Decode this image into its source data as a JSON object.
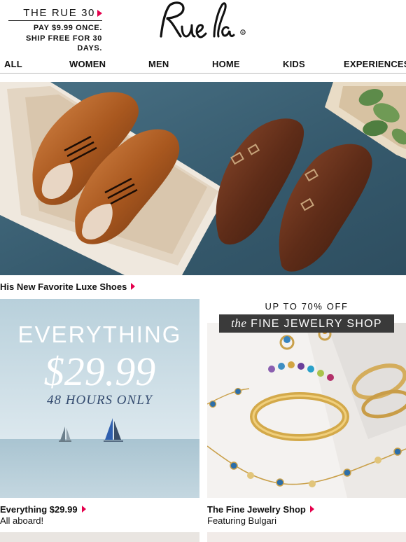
{
  "promo": {
    "title": "THE RUE 30",
    "line1": "PAY $9.99 ONCE.",
    "line2": "SHIP FREE FOR 30 DAYS."
  },
  "logo": {
    "text": "Rue la la"
  },
  "nav": {
    "items": [
      "ALL",
      "WOMEN",
      "MEN",
      "HOME",
      "KIDS",
      "EXPERIENCES"
    ]
  },
  "hero": {
    "caption": "His New Favorite Luxe Shoes"
  },
  "tiles": [
    {
      "headline": "EVERYTHING",
      "price": "$29.99",
      "subline": "48 HOURS ONLY",
      "caption": "Everything $29.99",
      "subcaption": "All aboard!"
    },
    {
      "discount": "UP TO 70% OFF",
      "banner_prefix": "the",
      "banner_main": "FINE JEWELRY SHOP",
      "caption": "The Fine Jewelry Shop",
      "subcaption": "Featuring Bulgari"
    }
  ],
  "colors": {
    "accent": "#e5004c",
    "hero_bg": "#3e6579",
    "sky": "#c9dbe4"
  }
}
